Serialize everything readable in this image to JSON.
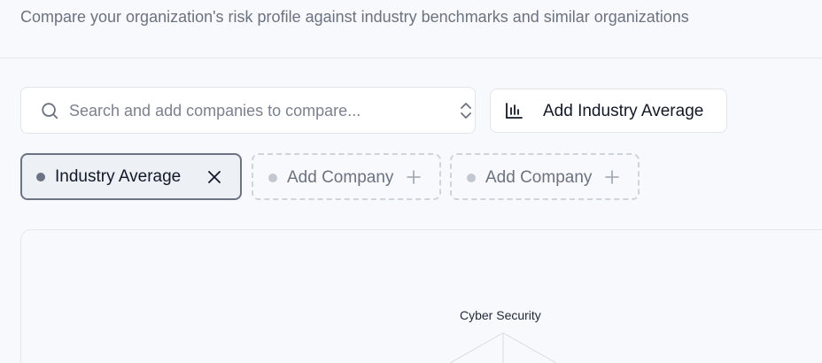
{
  "header": {
    "subtitle": "Compare your organization's risk profile against industry benchmarks and similar organizations"
  },
  "search": {
    "placeholder": "Search and add companies to compare..."
  },
  "toolbar": {
    "add_industry_label": "Add Industry Average"
  },
  "chips": [
    {
      "label": "Industry Average",
      "state": "selected",
      "icon": "close-icon"
    },
    {
      "label": "Add Company",
      "state": "empty",
      "icon": "plus-icon"
    },
    {
      "label": "Add Company",
      "state": "empty",
      "icon": "plus-icon"
    }
  ],
  "chart": {
    "axes": [
      "Cyber Security"
    ]
  },
  "colors": {
    "selected_dot": "#6b7384",
    "empty_dot": "#c3c8d0",
    "muted_text": "#6b7280"
  }
}
